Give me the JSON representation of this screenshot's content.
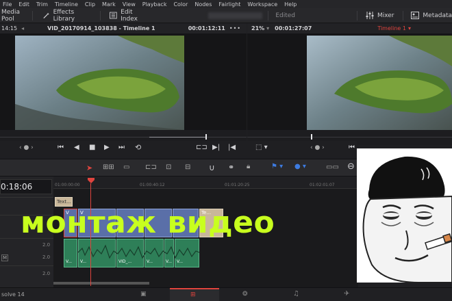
{
  "menu": [
    "File",
    "Edit",
    "Trim",
    "Timeline",
    "Clip",
    "Mark",
    "View",
    "Playback",
    "Color",
    "Nodes",
    "Fairlight",
    "Workspace",
    "Help"
  ],
  "toolbar": {
    "media_pool": "Media Pool",
    "effects_library": "Effects Library",
    "edit_index": "Edit Index",
    "edited": "Edited",
    "mixer": "Mixer",
    "metadata": "Metadata"
  },
  "source_viewer": {
    "left_timecode": "14:15",
    "title": "VID_20170914_103838 - Timeline 1",
    "timecode": "00:01:12:11",
    "zoom": "21%",
    "duration": "00:01:27:07"
  },
  "timeline_viewer": {
    "title": "Timeline 1"
  },
  "timeline": {
    "current_timecode": "0:18:06",
    "ruler": [
      "01:00:00:00",
      "01:00:40:12",
      "01:01:20:25",
      "01:02:01:07"
    ],
    "title_clip": "Text...",
    "video_clip_labels": [
      "V",
      "V",
      "Te..."
    ],
    "audio_clip_labels": [
      "V...",
      "V...",
      "VID_...",
      "V...",
      "V...",
      "V..."
    ],
    "track_levels": [
      "2.0",
      "2.0",
      "2.0"
    ],
    "mute_label": "M"
  },
  "overlay_text": "монтаж видео",
  "status": {
    "app_name": "solve 14"
  },
  "colors": {
    "accent_red": "#e0443e",
    "overlay_green": "#c8ff1e",
    "video_clip": "#5a6fa8",
    "audio_clip": "#2e7f58"
  }
}
